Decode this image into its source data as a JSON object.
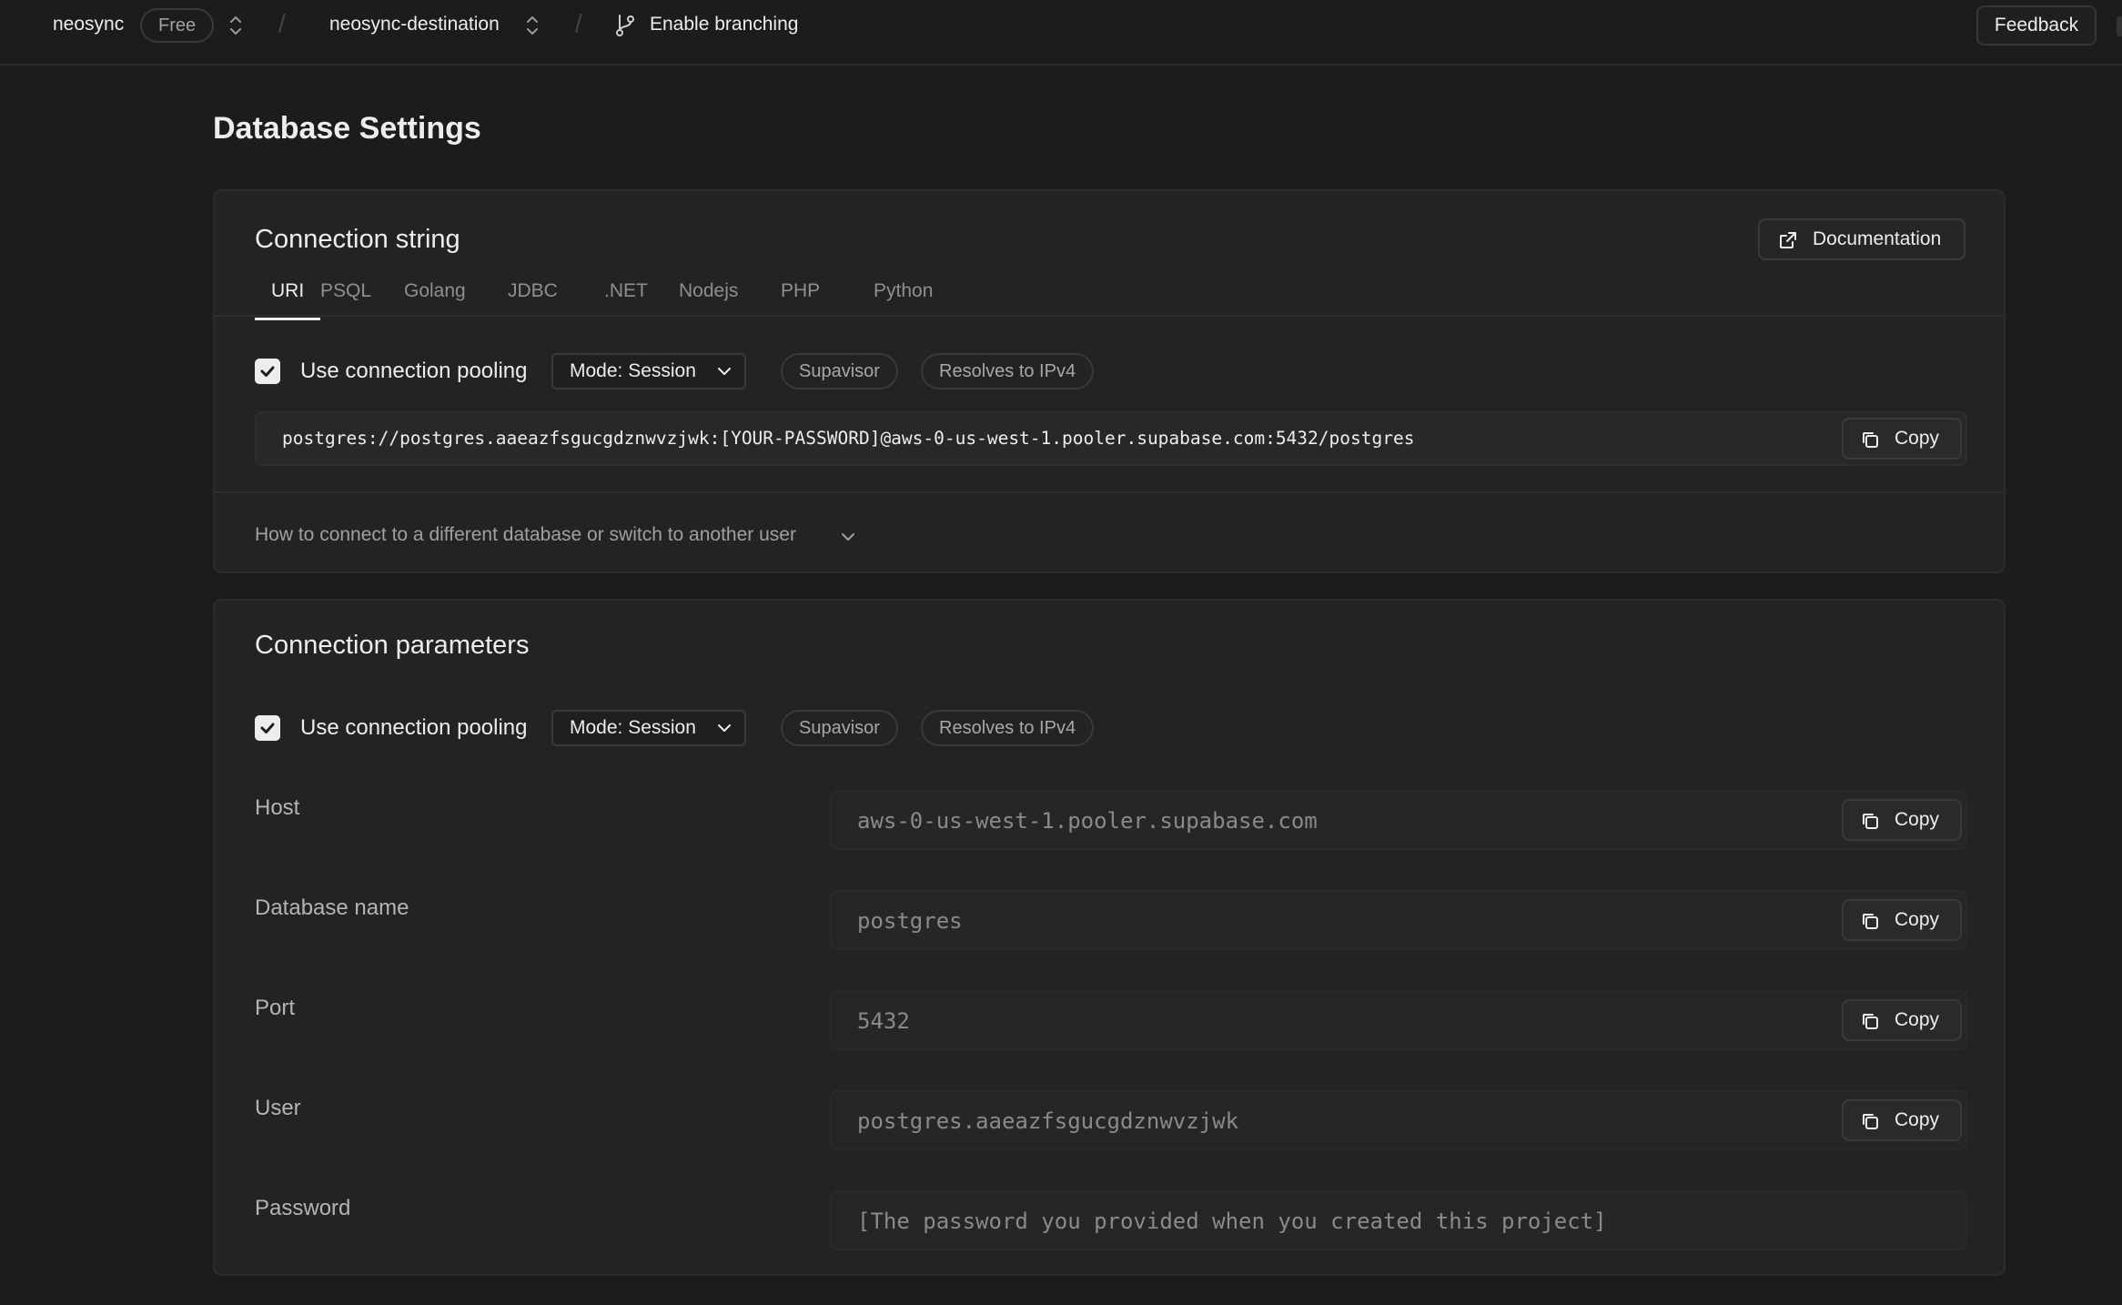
{
  "topbar": {
    "org_name": "neosync",
    "plan_badge": "Free",
    "project_name": "neosync-destination",
    "branching_label": "Enable branching",
    "feedback_label": "Feedback"
  },
  "page": {
    "title": "Database Settings"
  },
  "connection_string": {
    "title": "Connection string",
    "documentation_label": "Documentation",
    "tabs": [
      {
        "label": "URI",
        "active": true
      },
      {
        "label": "PSQL"
      },
      {
        "label": "Golang"
      },
      {
        "label": "JDBC"
      },
      {
        "label": ".NET"
      },
      {
        "label": "Nodejs"
      },
      {
        "label": "PHP"
      },
      {
        "label": "Python"
      }
    ],
    "pooling": {
      "label": "Use connection pooling",
      "checked": true,
      "mode": "Mode: Session",
      "badges": [
        "Supavisor",
        "Resolves to IPv4"
      ]
    },
    "uri": "postgres://postgres.aaeazfsgucgdznwvzjwk:[YOUR-PASSWORD]@aws-0-us-west-1.pooler.supabase.com:5432/postgres",
    "copy_label": "Copy",
    "help_text": "How to connect to a different database or switch to another user"
  },
  "connection_parameters": {
    "title": "Connection parameters",
    "pooling": {
      "label": "Use connection pooling",
      "checked": true,
      "mode": "Mode: Session",
      "badges": [
        "Supavisor",
        "Resolves to IPv4"
      ]
    },
    "copy_label": "Copy",
    "fields": [
      {
        "label": "Host",
        "value": "aws-0-us-west-1.pooler.supabase.com"
      },
      {
        "label": "Database name",
        "value": "postgres"
      },
      {
        "label": "Port",
        "value": "5432"
      },
      {
        "label": "User",
        "value": "postgres.aaeazfsgucgdznwvzjwk"
      },
      {
        "label": "Password",
        "value": "[The password you provided when you created this project]"
      }
    ]
  }
}
